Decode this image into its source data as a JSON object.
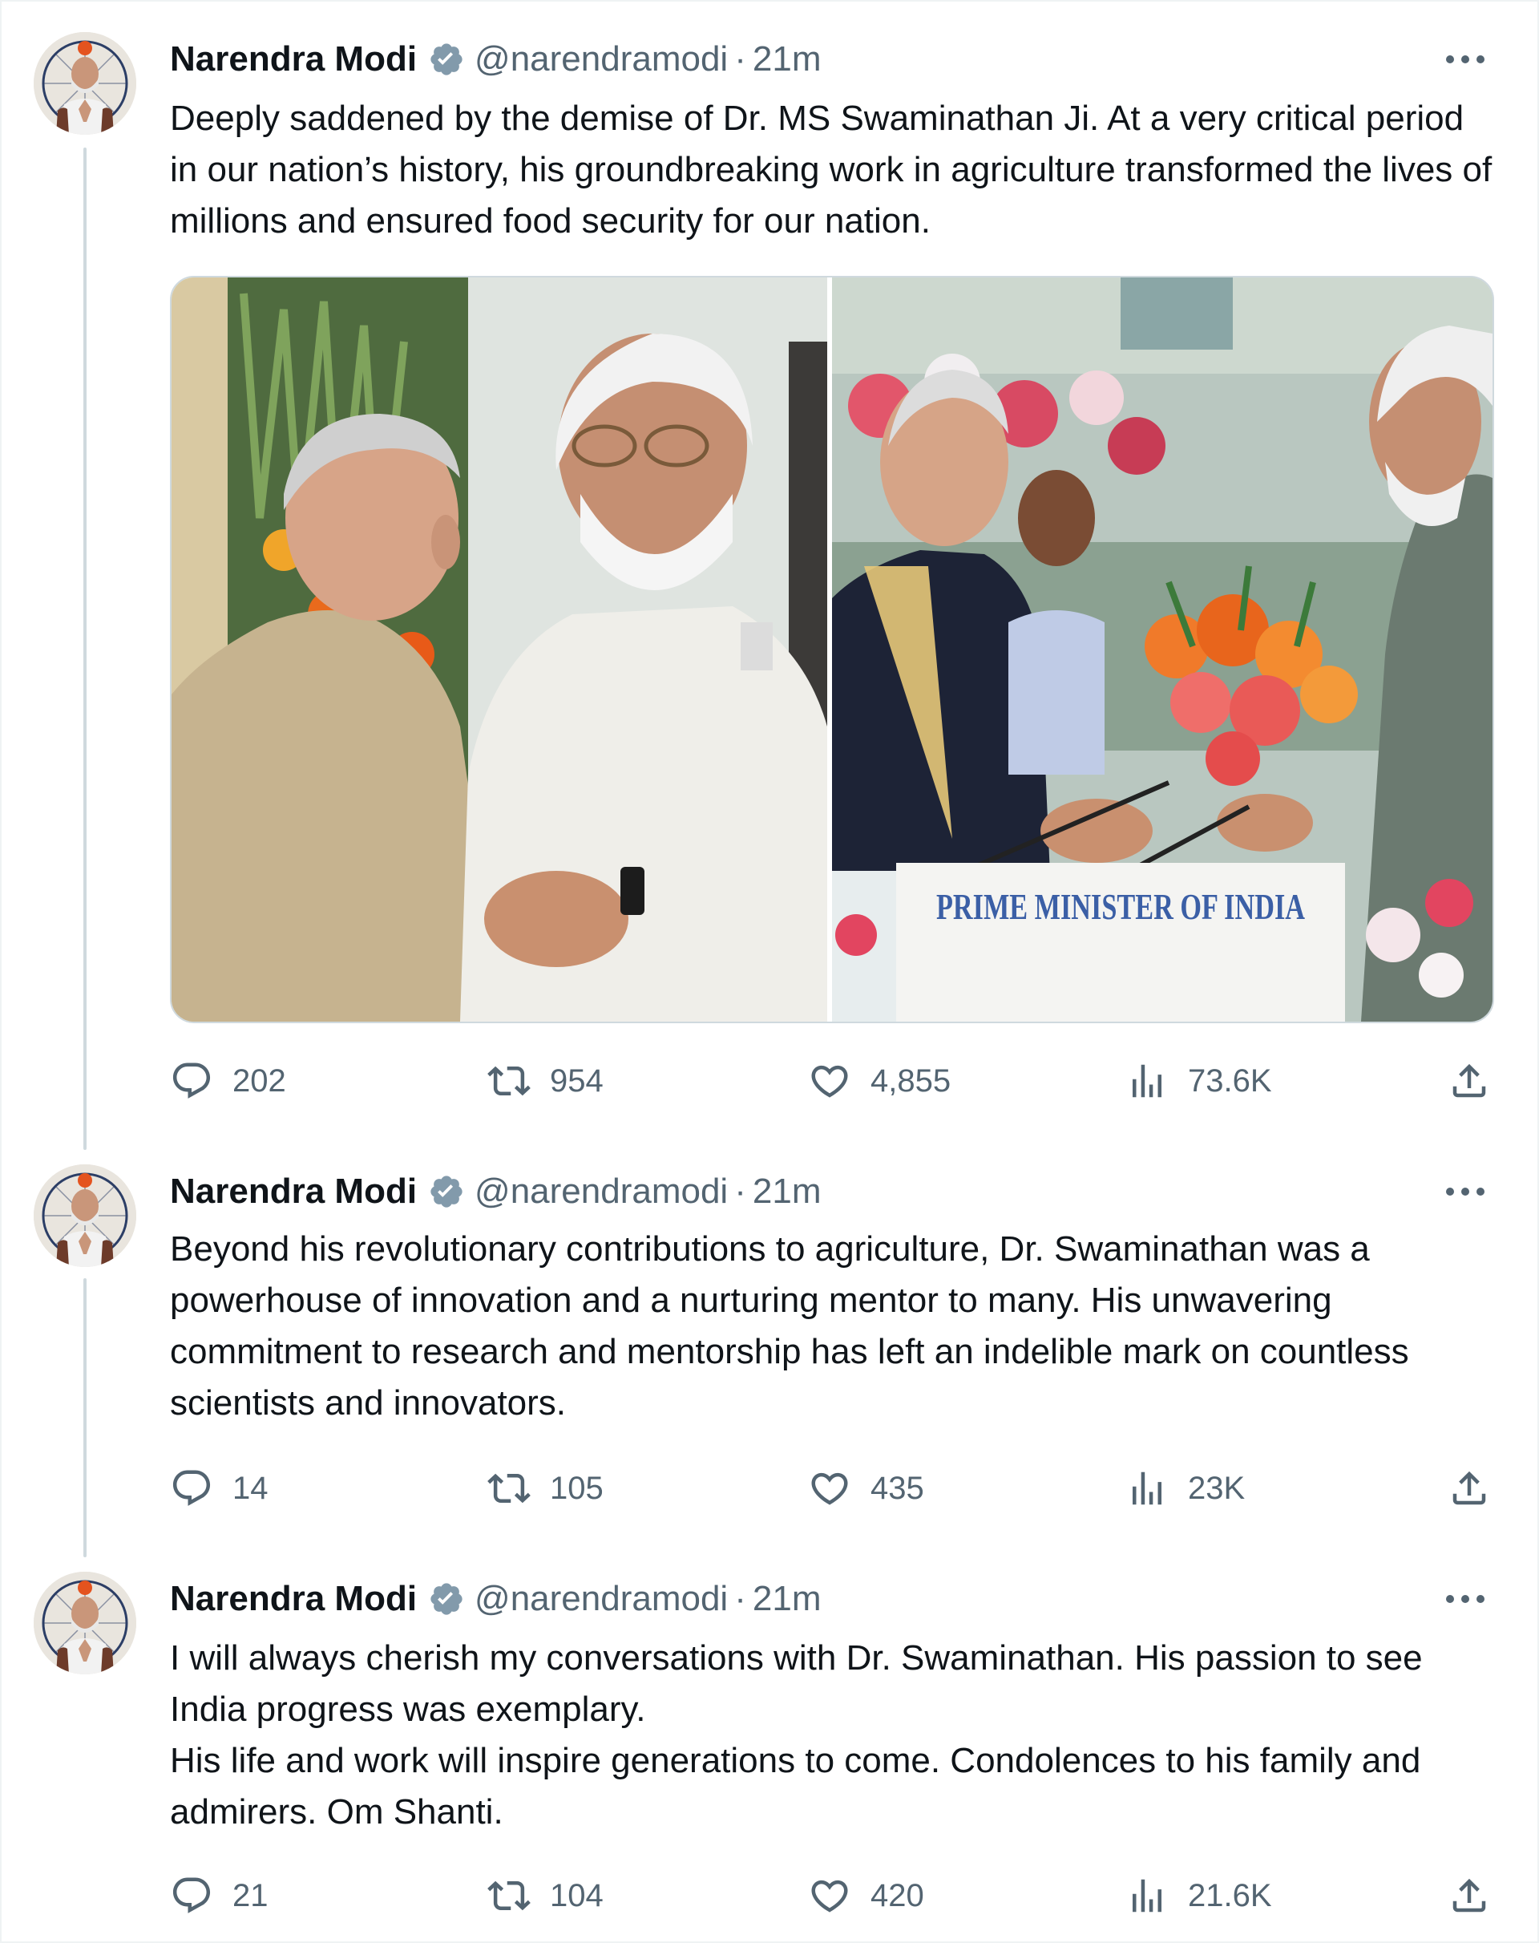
{
  "tweets": [
    {
      "author_name": "Narendra Modi",
      "handle": "@narendramodi",
      "separator": "·",
      "time": "21m",
      "text": "Deeply saddened by the demise of Dr. MS Swaminathan Ji. At a very critical period in our nation’s history, his groundbreaking work in agriculture transformed the lives of millions and ensured food security for our nation.",
      "media": {
        "left_photo": "handshake-photo-1",
        "right_photo": "handshake-photo-2",
        "placard_text": "PRIME MINISTER OF INDIA"
      },
      "replies": "202",
      "reposts": "954",
      "likes": "4,855",
      "views": "73.6K"
    },
    {
      "author_name": "Narendra Modi",
      "handle": "@narendramodi",
      "separator": "·",
      "time": "21m",
      "text": "Beyond his revolutionary contributions to agriculture, Dr. Swaminathan was a powerhouse of innovation and a nurturing mentor to many. His unwavering commitment to research and mentorship has left an indelible mark on countless scientists and innovators.",
      "replies": "14",
      "reposts": "105",
      "likes": "435",
      "views": "23K"
    },
    {
      "author_name": "Narendra Modi",
      "handle": "@narendramodi",
      "separator": "·",
      "time": "21m",
      "text": "I will always cherish my conversations with Dr. Swaminathan. His passion to see India progress was exemplary.\nHis life and work will inspire generations to come. Condolences to his family and admirers. Om Shanti.",
      "replies": "21",
      "reposts": "104",
      "likes": "420",
      "views": "21.6K"
    }
  ],
  "icons": {
    "reply": "reply-icon",
    "repost": "repost-icon",
    "like": "like-icon",
    "views": "views-icon",
    "share": "share-icon",
    "more": "more-icon",
    "verified": "verified-badge-icon"
  },
  "colors": {
    "text": "#0f1419",
    "secondary": "#536471",
    "thread_line": "#cfd9de",
    "verified_badge": "#829aab"
  }
}
